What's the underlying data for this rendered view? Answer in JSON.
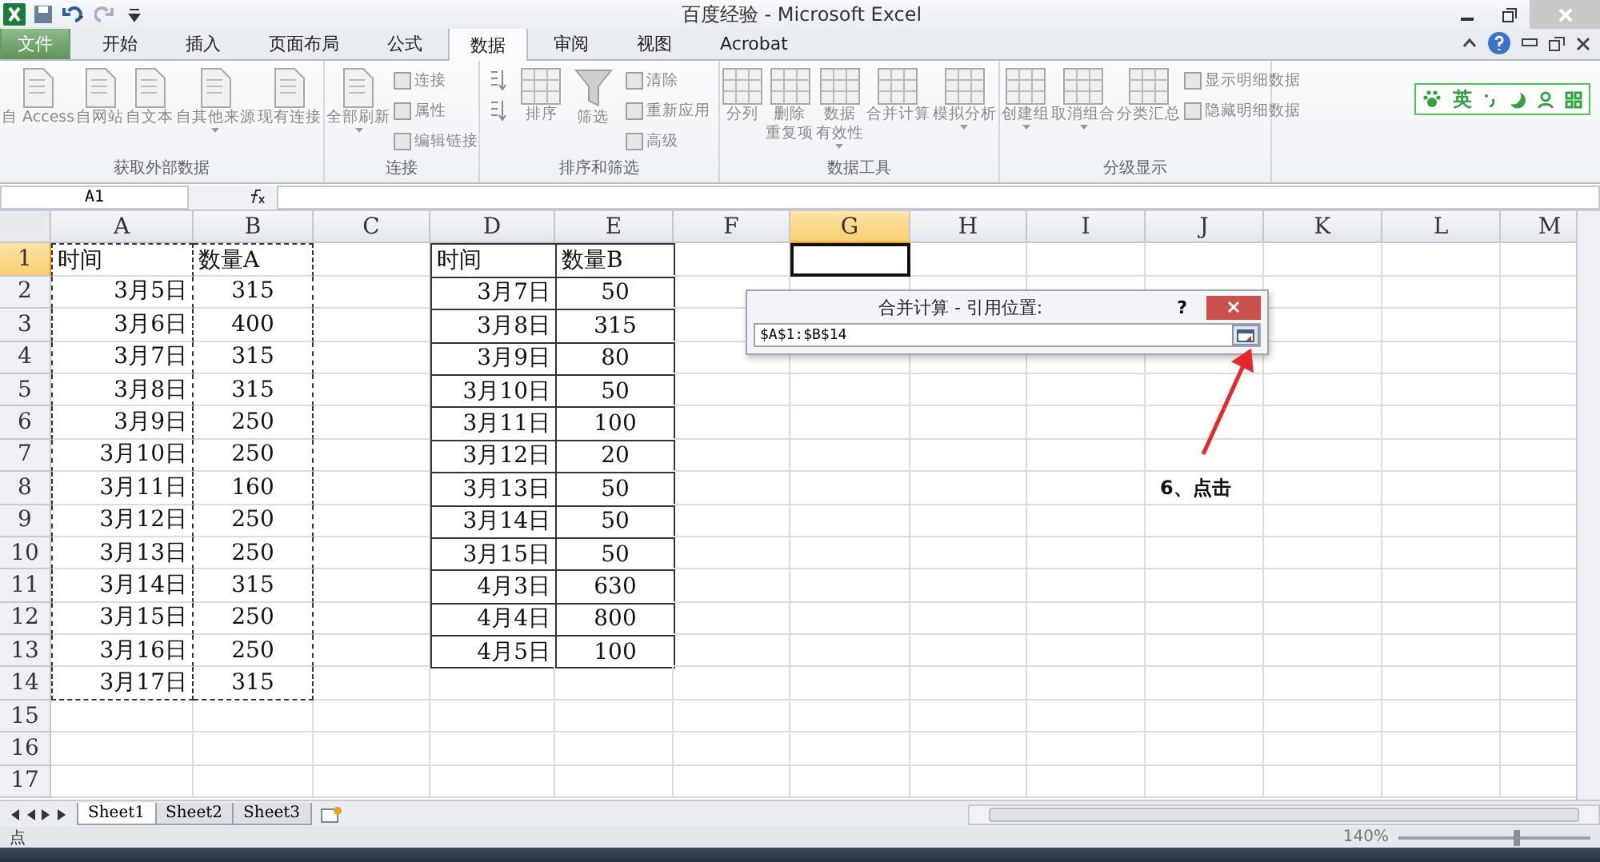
{
  "title_bar": {
    "title": "百度经验 - Microsoft Excel"
  },
  "ribbon_tabs": [
    {
      "label": "文件",
      "kind": "file",
      "selected": false
    },
    {
      "label": "开始",
      "kind": "tab",
      "selected": false
    },
    {
      "label": "插入",
      "kind": "tab",
      "selected": false
    },
    {
      "label": "页面布局",
      "kind": "tab",
      "selected": false
    },
    {
      "label": "公式",
      "kind": "tab",
      "selected": false
    },
    {
      "label": "数据",
      "kind": "tab",
      "selected": true
    },
    {
      "label": "审阅",
      "kind": "tab",
      "selected": false
    },
    {
      "label": "视图",
      "kind": "tab",
      "selected": false
    },
    {
      "label": "Acrobat",
      "kind": "tab",
      "selected": false
    }
  ],
  "ribbon": {
    "disabled": true,
    "groups": [
      {
        "label": "获取外部数据",
        "items": [
          {
            "kind": "large",
            "lines": [
              "自 Access"
            ],
            "dropdown": false
          },
          {
            "kind": "large",
            "lines": [
              "自网站"
            ],
            "dropdown": false
          },
          {
            "kind": "large",
            "lines": [
              "自文本"
            ],
            "dropdown": false
          },
          {
            "kind": "large",
            "lines": [
              "自其他来源"
            ],
            "dropdown": true
          },
          {
            "kind": "large",
            "lines": [
              "现有连接"
            ],
            "dropdown": false
          }
        ]
      },
      {
        "label": "连接",
        "items": [
          {
            "kind": "large",
            "lines": [
              "全部刷新"
            ],
            "dropdown": true
          },
          {
            "kind": "small",
            "label": "连接"
          },
          {
            "kind": "small",
            "label": "属性"
          },
          {
            "kind": "small",
            "label": "编辑链接"
          }
        ]
      },
      {
        "label": "排序和筛选",
        "items": [
          {
            "kind": "sort"
          },
          {
            "kind": "sort"
          },
          {
            "kind": "large",
            "lines": [
              "排序"
            ],
            "dropdown": false
          },
          {
            "kind": "large",
            "lines": [
              "筛选"
            ],
            "dropdown": false
          },
          {
            "kind": "small",
            "label": "清除"
          },
          {
            "kind": "small",
            "label": "重新应用"
          },
          {
            "kind": "small",
            "label": "高级"
          }
        ]
      },
      {
        "label": "数据工具",
        "items": [
          {
            "kind": "large",
            "lines": [
              "分列"
            ],
            "dropdown": false
          },
          {
            "kind": "large",
            "lines": [
              "删除",
              "重复项"
            ],
            "dropdown": false
          },
          {
            "kind": "large",
            "lines": [
              "数据",
              "有效性"
            ],
            "dropdown": true
          },
          {
            "kind": "large",
            "lines": [
              "合并计算"
            ],
            "dropdown": false
          },
          {
            "kind": "large",
            "lines": [
              "模拟分析"
            ],
            "dropdown": true
          }
        ]
      },
      {
        "label": "分级显示",
        "items": [
          {
            "kind": "large",
            "lines": [
              "创建组"
            ],
            "dropdown": true
          },
          {
            "kind": "large",
            "lines": [
              "取消组合"
            ],
            "dropdown": true
          },
          {
            "kind": "large",
            "lines": [
              "分类汇总"
            ],
            "dropdown": false
          },
          {
            "kind": "small",
            "label": "显示明细数据"
          },
          {
            "kind": "small",
            "label": "隐藏明细数据"
          }
        ]
      }
    ]
  },
  "ime": {
    "label": "英"
  },
  "formula_bar": {
    "name_box": "A1"
  },
  "columns": [
    {
      "label": "A",
      "selected": false
    },
    {
      "label": "B",
      "selected": false
    },
    {
      "label": "C",
      "selected": false
    },
    {
      "label": "D",
      "selected": false
    },
    {
      "label": "E",
      "selected": false
    },
    {
      "label": "F",
      "selected": false
    },
    {
      "label": "G",
      "selected": true
    },
    {
      "label": "H",
      "selected": false
    },
    {
      "label": "I",
      "selected": false
    },
    {
      "label": "J",
      "selected": false
    },
    {
      "label": "K",
      "selected": false
    },
    {
      "label": "L",
      "selected": false
    },
    {
      "label": "M",
      "selected": false
    }
  ],
  "rows": [
    {
      "number": "1",
      "selected": true,
      "marquee": true,
      "table": true,
      "a": "时间",
      "b": "数量A",
      "d": "时间",
      "e": "数量B"
    },
    {
      "number": "2",
      "selected": false,
      "marquee": true,
      "table": true,
      "a": "3月5日",
      "b": "315",
      "d": "3月7日",
      "e": "50"
    },
    {
      "number": "3",
      "selected": false,
      "marquee": true,
      "table": true,
      "a": "3月6日",
      "b": "400",
      "d": "3月8日",
      "e": "315"
    },
    {
      "number": "4",
      "selected": false,
      "marquee": true,
      "table": true,
      "a": "3月7日",
      "b": "315",
      "d": "3月9日",
      "e": "80"
    },
    {
      "number": "5",
      "selected": false,
      "marquee": true,
      "table": true,
      "a": "3月8日",
      "b": "315",
      "d": "3月10日",
      "e": "50"
    },
    {
      "number": "6",
      "selected": false,
      "marquee": true,
      "table": true,
      "a": "3月9日",
      "b": "250",
      "d": "3月11日",
      "e": "100"
    },
    {
      "number": "7",
      "selected": false,
      "marquee": true,
      "table": true,
      "a": "3月10日",
      "b": "250",
      "d": "3月12日",
      "e": "20"
    },
    {
      "number": "8",
      "selected": false,
      "marquee": true,
      "table": true,
      "a": "3月11日",
      "b": "160",
      "d": "3月13日",
      "e": "50"
    },
    {
      "number": "9",
      "selected": false,
      "marquee": true,
      "table": true,
      "a": "3月12日",
      "b": "250",
      "d": "3月14日",
      "e": "50"
    },
    {
      "number": "10",
      "selected": false,
      "marquee": true,
      "table": true,
      "a": "3月13日",
      "b": "250",
      "d": "3月15日",
      "e": "50"
    },
    {
      "number": "11",
      "selected": false,
      "marquee": true,
      "table": true,
      "a": "3月14日",
      "b": "315",
      "d": "4月3日",
      "e": "630"
    },
    {
      "number": "12",
      "selected": false,
      "marquee": true,
      "table": true,
      "a": "3月15日",
      "b": "250",
      "d": "4月4日",
      "e": "800"
    },
    {
      "number": "13",
      "selected": false,
      "marquee": true,
      "table": true,
      "a": "3月16日",
      "b": "250",
      "d": "4月5日",
      "e": "100"
    },
    {
      "number": "14",
      "selected": false,
      "marquee": true,
      "table": false,
      "a": "3月17日",
      "b": "315"
    },
    {
      "number": "15",
      "selected": false,
      "marquee": false,
      "table": false
    },
    {
      "number": "16",
      "selected": false,
      "marquee": false,
      "table": false
    },
    {
      "number": "17",
      "selected": false,
      "marquee": false,
      "table": false
    }
  ],
  "dialog": {
    "title": "合并计算 - 引用位置:",
    "help": "?",
    "reference": "$A$1:$B$14"
  },
  "annotation": {
    "label": "6、点击"
  },
  "sheet_tabs": [
    {
      "label": "Sheet1",
      "selected": true
    },
    {
      "label": "Sheet2",
      "selected": false
    },
    {
      "label": "Sheet3",
      "selected": false
    }
  ],
  "status_bar": {
    "mode": "点",
    "zoom": "140%",
    "level": 0.6
  }
}
